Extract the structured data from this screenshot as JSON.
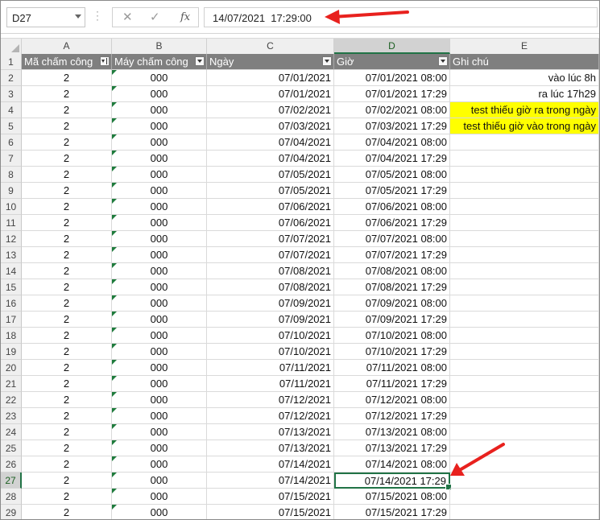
{
  "formula_bar": {
    "name_box": "D27",
    "formula": "14/07/2021  17:29:00",
    "cancel_icon": "x-icon",
    "enter_icon": "check-icon",
    "function_label": "fx"
  },
  "columns": [
    "A",
    "B",
    "C",
    "D",
    "E"
  ],
  "selected_column": "D",
  "header_row": {
    "row_number": "1",
    "cells": [
      "Mã chấm công",
      "Máy chấm công",
      "Ngày",
      "Giờ",
      "Ghi chú"
    ]
  },
  "rows": [
    {
      "n": "2",
      "a": "2",
      "b": "000",
      "c": "07/01/2021",
      "d": "07/01/2021 08:00",
      "e": "vào lúc 8h",
      "hl": false
    },
    {
      "n": "3",
      "a": "2",
      "b": "000",
      "c": "07/01/2021",
      "d": "07/01/2021 17:29",
      "e": "ra lúc 17h29",
      "hl": false
    },
    {
      "n": "4",
      "a": "2",
      "b": "000",
      "c": "07/02/2021",
      "d": "07/02/2021 08:00",
      "e": "test thiếu giờ ra trong ngày",
      "hl": true
    },
    {
      "n": "5",
      "a": "2",
      "b": "000",
      "c": "07/03/2021",
      "d": "07/03/2021 17:29",
      "e": "test thiếu giờ vào trong ngày",
      "hl": true
    },
    {
      "n": "6",
      "a": "2",
      "b": "000",
      "c": "07/04/2021",
      "d": "07/04/2021 08:00",
      "e": "",
      "hl": false
    },
    {
      "n": "7",
      "a": "2",
      "b": "000",
      "c": "07/04/2021",
      "d": "07/04/2021 17:29",
      "e": "",
      "hl": false
    },
    {
      "n": "8",
      "a": "2",
      "b": "000",
      "c": "07/05/2021",
      "d": "07/05/2021 08:00",
      "e": "",
      "hl": false
    },
    {
      "n": "9",
      "a": "2",
      "b": "000",
      "c": "07/05/2021",
      "d": "07/05/2021 17:29",
      "e": "",
      "hl": false
    },
    {
      "n": "10",
      "a": "2",
      "b": "000",
      "c": "07/06/2021",
      "d": "07/06/2021 08:00",
      "e": "",
      "hl": false
    },
    {
      "n": "11",
      "a": "2",
      "b": "000",
      "c": "07/06/2021",
      "d": "07/06/2021 17:29",
      "e": "",
      "hl": false
    },
    {
      "n": "12",
      "a": "2",
      "b": "000",
      "c": "07/07/2021",
      "d": "07/07/2021 08:00",
      "e": "",
      "hl": false
    },
    {
      "n": "13",
      "a": "2",
      "b": "000",
      "c": "07/07/2021",
      "d": "07/07/2021 17:29",
      "e": "",
      "hl": false
    },
    {
      "n": "14",
      "a": "2",
      "b": "000",
      "c": "07/08/2021",
      "d": "07/08/2021 08:00",
      "e": "",
      "hl": false
    },
    {
      "n": "15",
      "a": "2",
      "b": "000",
      "c": "07/08/2021",
      "d": "07/08/2021 17:29",
      "e": "",
      "hl": false
    },
    {
      "n": "16",
      "a": "2",
      "b": "000",
      "c": "07/09/2021",
      "d": "07/09/2021 08:00",
      "e": "",
      "hl": false
    },
    {
      "n": "17",
      "a": "2",
      "b": "000",
      "c": "07/09/2021",
      "d": "07/09/2021 17:29",
      "e": "",
      "hl": false
    },
    {
      "n": "18",
      "a": "2",
      "b": "000",
      "c": "07/10/2021",
      "d": "07/10/2021 08:00",
      "e": "",
      "hl": false
    },
    {
      "n": "19",
      "a": "2",
      "b": "000",
      "c": "07/10/2021",
      "d": "07/10/2021 17:29",
      "e": "",
      "hl": false
    },
    {
      "n": "20",
      "a": "2",
      "b": "000",
      "c": "07/11/2021",
      "d": "07/11/2021 08:00",
      "e": "",
      "hl": false
    },
    {
      "n": "21",
      "a": "2",
      "b": "000",
      "c": "07/11/2021",
      "d": "07/11/2021 17:29",
      "e": "",
      "hl": false
    },
    {
      "n": "22",
      "a": "2",
      "b": "000",
      "c": "07/12/2021",
      "d": "07/12/2021 08:00",
      "e": "",
      "hl": false
    },
    {
      "n": "23",
      "a": "2",
      "b": "000",
      "c": "07/12/2021",
      "d": "07/12/2021 17:29",
      "e": "",
      "hl": false
    },
    {
      "n": "24",
      "a": "2",
      "b": "000",
      "c": "07/13/2021",
      "d": "07/13/2021 08:00",
      "e": "",
      "hl": false
    },
    {
      "n": "25",
      "a": "2",
      "b": "000",
      "c": "07/13/2021",
      "d": "07/13/2021 17:29",
      "e": "",
      "hl": false
    },
    {
      "n": "26",
      "a": "2",
      "b": "000",
      "c": "07/14/2021",
      "d": "07/14/2021 08:00",
      "e": "",
      "hl": false
    },
    {
      "n": "27",
      "a": "2",
      "b": "000",
      "c": "07/14/2021",
      "d": "07/14/2021 17:29",
      "e": "",
      "hl": false,
      "selected": true
    },
    {
      "n": "28",
      "a": "2",
      "b": "000",
      "c": "07/15/2021",
      "d": "07/15/2021 08:00",
      "e": "",
      "hl": false
    },
    {
      "n": "29",
      "a": "2",
      "b": "000",
      "c": "07/15/2021",
      "d": "07/15/2021 17:29",
      "e": "",
      "hl": false
    }
  ],
  "colors": {
    "header_fill": "#7f7f7f",
    "highlight": "#ffff00",
    "selection": "#217346",
    "arrow": "#e8211e"
  }
}
